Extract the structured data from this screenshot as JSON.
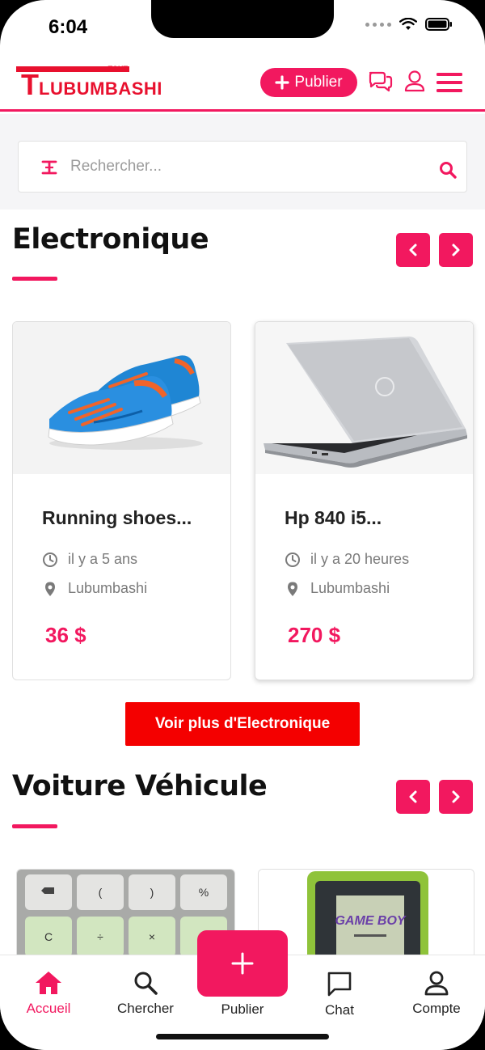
{
  "status_bar": {
    "time": "6:04"
  },
  "header": {
    "logo": {
      "small": "TOUT",
      "big_letter": "T",
      "word": "LUBUMBASHI"
    },
    "publish_label": "Publier",
    "icons": [
      "chat-bubbles-icon",
      "user-icon",
      "hamburger-menu-icon"
    ]
  },
  "search": {
    "placeholder": "Rechercher..."
  },
  "sections": [
    {
      "title": "Electronique",
      "more_label": "Voir plus d'Electronique",
      "items": [
        {
          "title": "Running shoes...",
          "time": "il y a 5 ans",
          "location": "Lubumbashi",
          "price": "36 $",
          "image": "blue-running-shoes"
        },
        {
          "title": "Hp 840 i5...",
          "time": "il y a 20 heures",
          "location": "Lubumbashi",
          "price": "270 $",
          "image": "silver-laptop"
        }
      ]
    },
    {
      "title": "Voiture Véhicule",
      "items": [
        {
          "image": "calculator-keypad",
          "keys": [
            "",
            "(",
            ")",
            "%",
            "C",
            "÷",
            "×",
            ""
          ]
        },
        {
          "image": "game-boy",
          "logo_text": "GAME BOY"
        }
      ]
    }
  ],
  "tabbar": {
    "tabs": [
      {
        "label": "Accueil",
        "icon": "home-icon",
        "active": true
      },
      {
        "label": "Chercher",
        "icon": "search-icon",
        "active": false
      },
      {
        "label": "Publier",
        "icon": "plus-icon",
        "active": false
      },
      {
        "label": "Chat",
        "icon": "chat-icon",
        "active": false
      },
      {
        "label": "Compte",
        "icon": "account-icon",
        "active": false
      }
    ]
  },
  "colors": {
    "accent": "#f2185f",
    "button_red": "#f40000",
    "logo_red": "#e8102e"
  }
}
